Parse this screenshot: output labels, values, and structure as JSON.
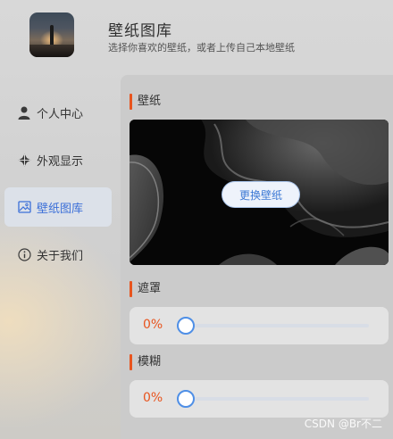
{
  "header": {
    "title": "壁纸图库",
    "subtitle": "选择你喜欢的壁纸，或者上传自己本地壁纸"
  },
  "sidebar": {
    "items": [
      {
        "label": "个人中心",
        "icon": "user-icon",
        "active": false
      },
      {
        "label": "外观显示",
        "icon": "appearance-icon",
        "active": false
      },
      {
        "label": "壁纸图库",
        "icon": "image-icon",
        "active": true
      },
      {
        "label": "关于我们",
        "icon": "info-icon",
        "active": false
      }
    ]
  },
  "wallpaper_section": {
    "title": "壁纸",
    "change_button": "更换壁纸"
  },
  "mask_section": {
    "title": "遮罩",
    "value_text": "0%",
    "value": 0
  },
  "blur_section": {
    "title": "模糊",
    "value_text": "0%",
    "value": 0
  },
  "watermark": "CSDN @Br不二",
  "colors": {
    "accent": "#3b6fd8",
    "section_marker": "#e8541e",
    "value_text": "#e8541e",
    "slider": "#4f8fe6"
  }
}
